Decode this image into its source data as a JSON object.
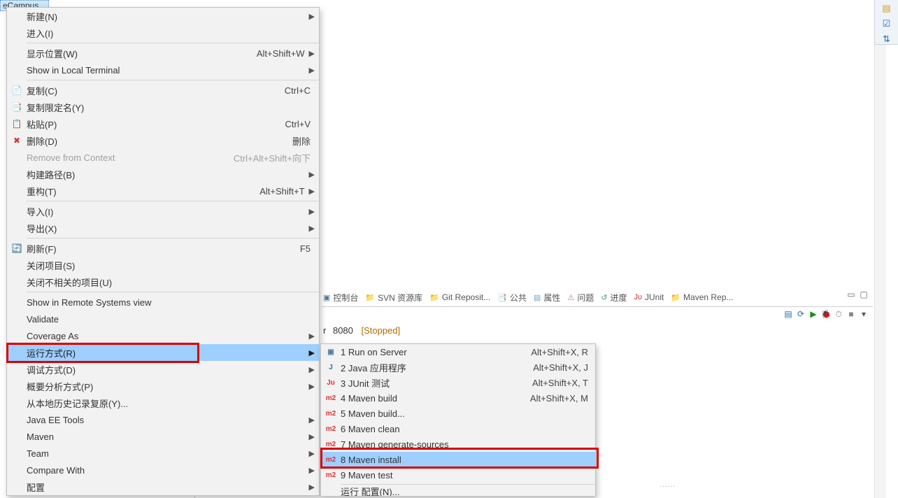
{
  "tree_selected": "eCampus",
  "context_menu": {
    "groups": [
      [
        {
          "key": "new",
          "icon": "",
          "label": "新建(N)",
          "shortcut": "",
          "submenu": true
        },
        {
          "key": "into",
          "icon": "",
          "label": "进入(I)",
          "shortcut": "",
          "submenu": false
        }
      ],
      [
        {
          "key": "showin",
          "icon": "",
          "label": "显示位置(W)",
          "shortcut": "Alt+Shift+W",
          "submenu": true
        },
        {
          "key": "localterm",
          "icon": "",
          "label": "Show in Local Terminal",
          "shortcut": "",
          "submenu": true
        }
      ],
      [
        {
          "key": "copy",
          "icon": "📄",
          "label": "复制(C)",
          "shortcut": "Ctrl+C"
        },
        {
          "key": "copyqn",
          "icon": "📑",
          "label": "复制限定名(Y)",
          "shortcut": ""
        },
        {
          "key": "paste",
          "icon": "📋",
          "label": "粘贴(P)",
          "shortcut": "Ctrl+V"
        },
        {
          "key": "delete",
          "icon": "✖",
          "label": "删除(D)",
          "shortcut": "删除",
          "iconColor": "#d33"
        },
        {
          "key": "removectx",
          "icon": "",
          "label": "Remove from Context",
          "shortcut": "Ctrl+Alt+Shift+向下",
          "disabled": true
        },
        {
          "key": "buildpath",
          "icon": "",
          "label": "构建路径(B)",
          "shortcut": "",
          "submenu": true
        },
        {
          "key": "refactor",
          "icon": "",
          "label": "重构(T)",
          "shortcut": "Alt+Shift+T",
          "submenu": true
        }
      ],
      [
        {
          "key": "import",
          "icon": "",
          "label": "导入(I)",
          "shortcut": "",
          "submenu": true
        },
        {
          "key": "export",
          "icon": "",
          "label": "导出(X)",
          "shortcut": "",
          "submenu": true
        }
      ],
      [
        {
          "key": "refresh",
          "icon": "🔄",
          "label": "刷新(F)",
          "shortcut": "F5"
        },
        {
          "key": "closeproj",
          "icon": "",
          "label": "关闭项目(S)",
          "shortcut": ""
        },
        {
          "key": "closeunrel",
          "icon": "",
          "label": "关闭不相关的项目(U)",
          "shortcut": ""
        }
      ],
      [
        {
          "key": "remoteview",
          "icon": "",
          "label": "Show in Remote Systems view",
          "shortcut": ""
        },
        {
          "key": "validate",
          "icon": "",
          "label": "Validate",
          "shortcut": ""
        },
        {
          "key": "coverage",
          "icon": "",
          "label": "Coverage As",
          "shortcut": "",
          "submenu": true
        },
        {
          "key": "runas",
          "icon": "",
          "label": "运行方式(R)",
          "shortcut": "",
          "submenu": true,
          "selected": true
        },
        {
          "key": "debugas",
          "icon": "",
          "label": "调试方式(D)",
          "shortcut": "",
          "submenu": true
        },
        {
          "key": "profileas",
          "icon": "",
          "label": "概要分析方式(P)",
          "shortcut": "",
          "submenu": true
        },
        {
          "key": "restorelocal",
          "icon": "",
          "label": "从本地历史记录复原(Y)...",
          "shortcut": ""
        },
        {
          "key": "jeetools",
          "icon": "",
          "label": "Java EE Tools",
          "shortcut": "",
          "submenu": true
        },
        {
          "key": "maven",
          "icon": "",
          "label": "Maven",
          "shortcut": "",
          "submenu": true
        },
        {
          "key": "team",
          "icon": "",
          "label": "Team",
          "shortcut": "",
          "submenu": true
        },
        {
          "key": "comparewith",
          "icon": "",
          "label": "Compare With",
          "shortcut": "",
          "submenu": true
        },
        {
          "key": "configure",
          "icon": "",
          "label": "配置",
          "shortcut": "",
          "submenu": true
        }
      ]
    ]
  },
  "submenu": {
    "title": "运行方式",
    "items": [
      {
        "key": "runserver",
        "icon": "srv",
        "iconGlyph": "▣",
        "label": "1 Run on Server",
        "shortcut": "Alt+Shift+X, R"
      },
      {
        "key": "javaapp",
        "icon": "j",
        "iconGlyph": "J",
        "label": "2 Java 应用程序",
        "shortcut": "Alt+Shift+X, J"
      },
      {
        "key": "junit",
        "icon": "ju",
        "iconGlyph": "Jᴜ",
        "label": "3 JUnit 测试",
        "shortcut": "Alt+Shift+X, T"
      },
      {
        "key": "mvnbuild",
        "icon": "m2",
        "iconGlyph": "m2",
        "label": "4 Maven build",
        "shortcut": "Alt+Shift+X, M"
      },
      {
        "key": "mvnbuild2",
        "icon": "m2",
        "iconGlyph": "m2",
        "label": "5 Maven build...",
        "shortcut": ""
      },
      {
        "key": "mvnclean",
        "icon": "m2",
        "iconGlyph": "m2",
        "label": "6 Maven clean",
        "shortcut": ""
      },
      {
        "key": "mvngensrc",
        "icon": "m2",
        "iconGlyph": "m2",
        "label": "7 Maven generate-sources",
        "shortcut": ""
      },
      {
        "key": "mvninstall",
        "icon": "m2",
        "iconGlyph": "m2",
        "label": "8 Maven install",
        "shortcut": "",
        "selected": true
      },
      {
        "key": "mvntest",
        "icon": "m2",
        "iconGlyph": "m2",
        "label": "9 Maven test",
        "shortcut": ""
      }
    ],
    "sep_after": 8,
    "run_config": {
      "label": "运行 配置(N)..."
    }
  },
  "tabs": {
    "items": [
      {
        "key": "console",
        "icon": "▣",
        "label": "控制台",
        "clr": "#4d7aa0"
      },
      {
        "key": "svn",
        "icon": "📁",
        "label": "SVN 资源库",
        "clr": "#c2a200"
      },
      {
        "key": "git",
        "icon": "📁",
        "label": "Git Reposit...",
        "clr": "#cc8c00"
      },
      {
        "key": "public",
        "icon": "📑",
        "label": "公共",
        "clr": "#cc8c00"
      },
      {
        "key": "props",
        "icon": "▤",
        "label": "属性",
        "clr": "#6aa4d0"
      },
      {
        "key": "problems",
        "icon": "⚠",
        "label": "问题",
        "clr": "#c77"
      },
      {
        "key": "progress",
        "icon": "↺",
        "label": "进度",
        "clr": "#4aa06d"
      },
      {
        "key": "junit",
        "icon": "Jᴜ",
        "label": "JUnit",
        "clr": "#c33"
      },
      {
        "key": "mavenrep",
        "icon": "📁",
        "label": "Maven Rep...",
        "clr": "#6aa4d0"
      }
    ]
  },
  "server": {
    "cut_label": "r",
    "port": "8080",
    "status": "[Stopped]"
  }
}
